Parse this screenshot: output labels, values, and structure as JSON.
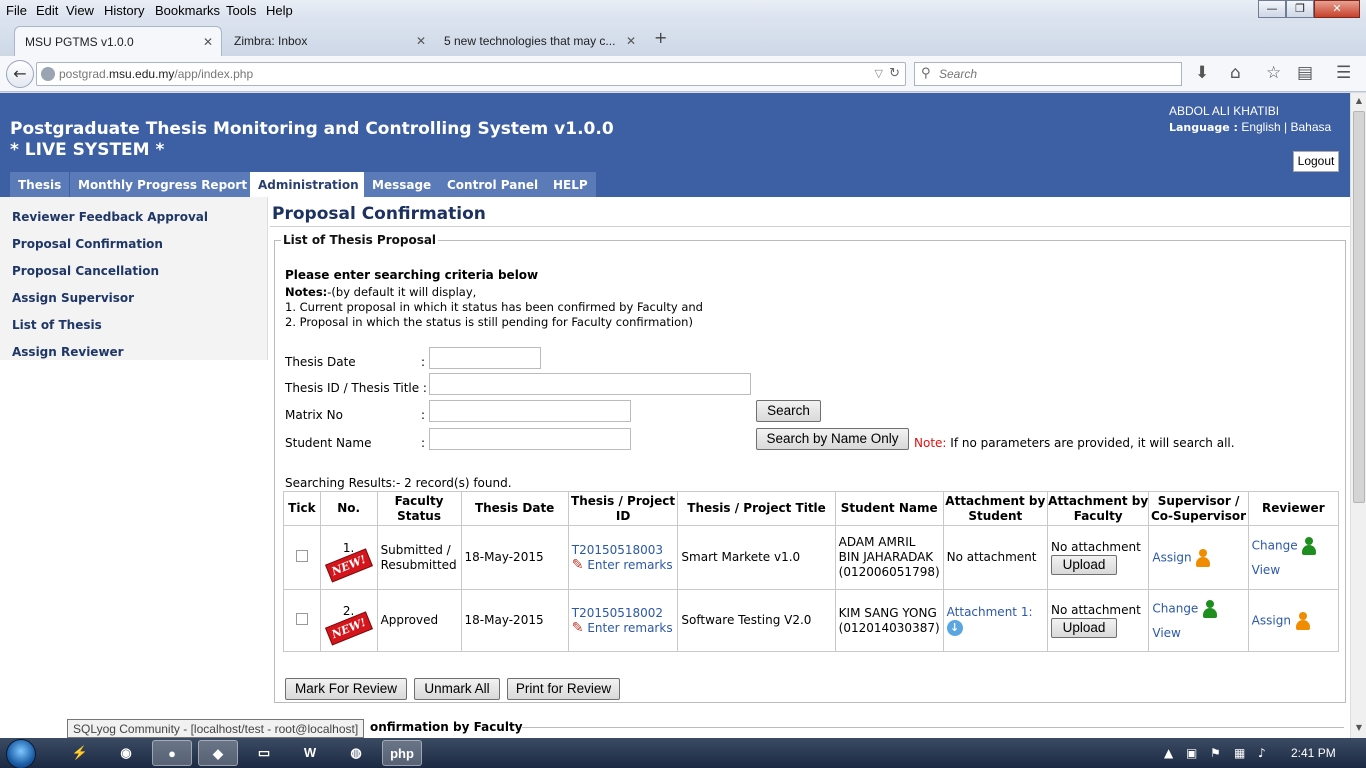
{
  "browser": {
    "menu": [
      "File",
      "Edit",
      "View",
      "History",
      "Bookmarks",
      "Tools",
      "Help"
    ],
    "window_buttons": [
      "—",
      "❐",
      "✕"
    ],
    "tabs": [
      {
        "label": "MSU PGTMS v1.0.0",
        "close": "✕"
      },
      {
        "label": "Zimbra: Inbox",
        "close": "✕"
      },
      {
        "label": "5 new technologies that may c...",
        "close": "✕"
      }
    ],
    "new_tab": "+",
    "back": "←",
    "url_prefix": "postgrad.",
    "url_domain": "msu.edu.my",
    "url_suffix": "/app/index.php",
    "search_placeholder": "Search",
    "nav_icons": [
      "download-icon",
      "home-icon",
      "bookmark-star-icon",
      "reading-list-icon",
      "menu-icon"
    ]
  },
  "header": {
    "title_line1": "Postgraduate Thesis Monitoring and Controlling System v1.0.0",
    "title_line2": "* LIVE SYSTEM *",
    "user_name": "ABDOL ALI KHATIBI",
    "language_label": "Language :",
    "lang_english": "English",
    "lang_sep": "|",
    "lang_bahasa": "Bahasa",
    "logout": "Logout"
  },
  "nav_tabs": [
    "Thesis",
    "Monthly Progress Report",
    "Administration",
    "Message",
    "Control Panel",
    "HELP"
  ],
  "active_nav_tab": "Administration",
  "sidebar": [
    "Reviewer Feedback Approval",
    "Proposal Confirmation",
    "Proposal Cancellation",
    "Assign Supervisor",
    "List of Thesis",
    "Assign Reviewer"
  ],
  "main": {
    "page_title": "Proposal Confirmation",
    "legend": "List of Thesis Proposal",
    "criteria_title": "Please enter searching criteria below",
    "notes_label": "Notes:",
    "notes_text": "-(by default it will display,",
    "note_1": "1. Current proposal in which it status has been confirmed by Faculty and",
    "note_2": "2. Proposal in which the status is still pending for Faculty confirmation)",
    "form": {
      "thesis_date_label": "Thesis Date",
      "thesis_id_label": "Thesis ID / Thesis Title :",
      "matrix_label": "Matrix No",
      "student_label": "Student Name",
      "colon": ":"
    },
    "search_button": "Search",
    "search_name_button": "Search by Name Only",
    "note_red": "Note:",
    "note_search": "If no parameters are provided, it will search all.",
    "results_summary": "Searching Results:- 2 record(s) found.",
    "table": {
      "headers": [
        "Tick",
        "No.",
        "Faculty Status",
        "Thesis Date",
        "Thesis / Project ID",
        "Thesis / Project Title",
        "Student Name",
        "Attachment by Student",
        "Attachment by Faculty",
        "Supervisor / Co-Supervisor",
        "Reviewer"
      ],
      "rows": [
        {
          "no": "1.",
          "badge": "NEW!",
          "status": "Submitted / Resubmitted",
          "date": "18-May-2015",
          "thesis_id": "T20150518003",
          "remarks": "Enter remarks",
          "title": "Smart Markete v1.0",
          "student": "ADAM AMRIL BIN JAHARADAK (012006051798)",
          "attach_student": "No attachment",
          "attach_faculty": "No attachment",
          "upload": "Upload",
          "supervisor_link": "Assign",
          "supervisor_icon": "orange",
          "reviewer_link": "Change",
          "reviewer_view": "View",
          "reviewer_icon": "green"
        },
        {
          "no": "2.",
          "badge": "NEW!",
          "status": "Approved",
          "date": "18-May-2015",
          "thesis_id": "T20150518002",
          "remarks": "Enter remarks",
          "title": "Software Testing V2.0",
          "student": "KIM SANG YONG (012014030387)",
          "attach_student": "Attachment 1:",
          "attach_faculty": "No attachment",
          "upload": "Upload",
          "supervisor_link": "Change",
          "supervisor_view": "View",
          "supervisor_icon": "green",
          "reviewer_link": "Assign",
          "reviewer_icon": "orange"
        }
      ]
    },
    "mark_button": "Mark For Review",
    "unmark_button": "Unmark All",
    "print_button": "Print for Review",
    "lower_legend": "onfirmation by Faculty"
  },
  "tooltip": "SQLyog Community - [localhost/test - root@localhost]",
  "taskbar": {
    "apps": [
      "winscp",
      "chrome",
      "firefox",
      "sqlyog",
      "explorer",
      "word",
      "app",
      "php"
    ],
    "clock": "2:41 PM"
  },
  "colors": {
    "header_bg": "#3d5fa3",
    "nav_tab_bg": "#5a7ab8",
    "link": "#2c58a8",
    "note_red": "#d11"
  }
}
